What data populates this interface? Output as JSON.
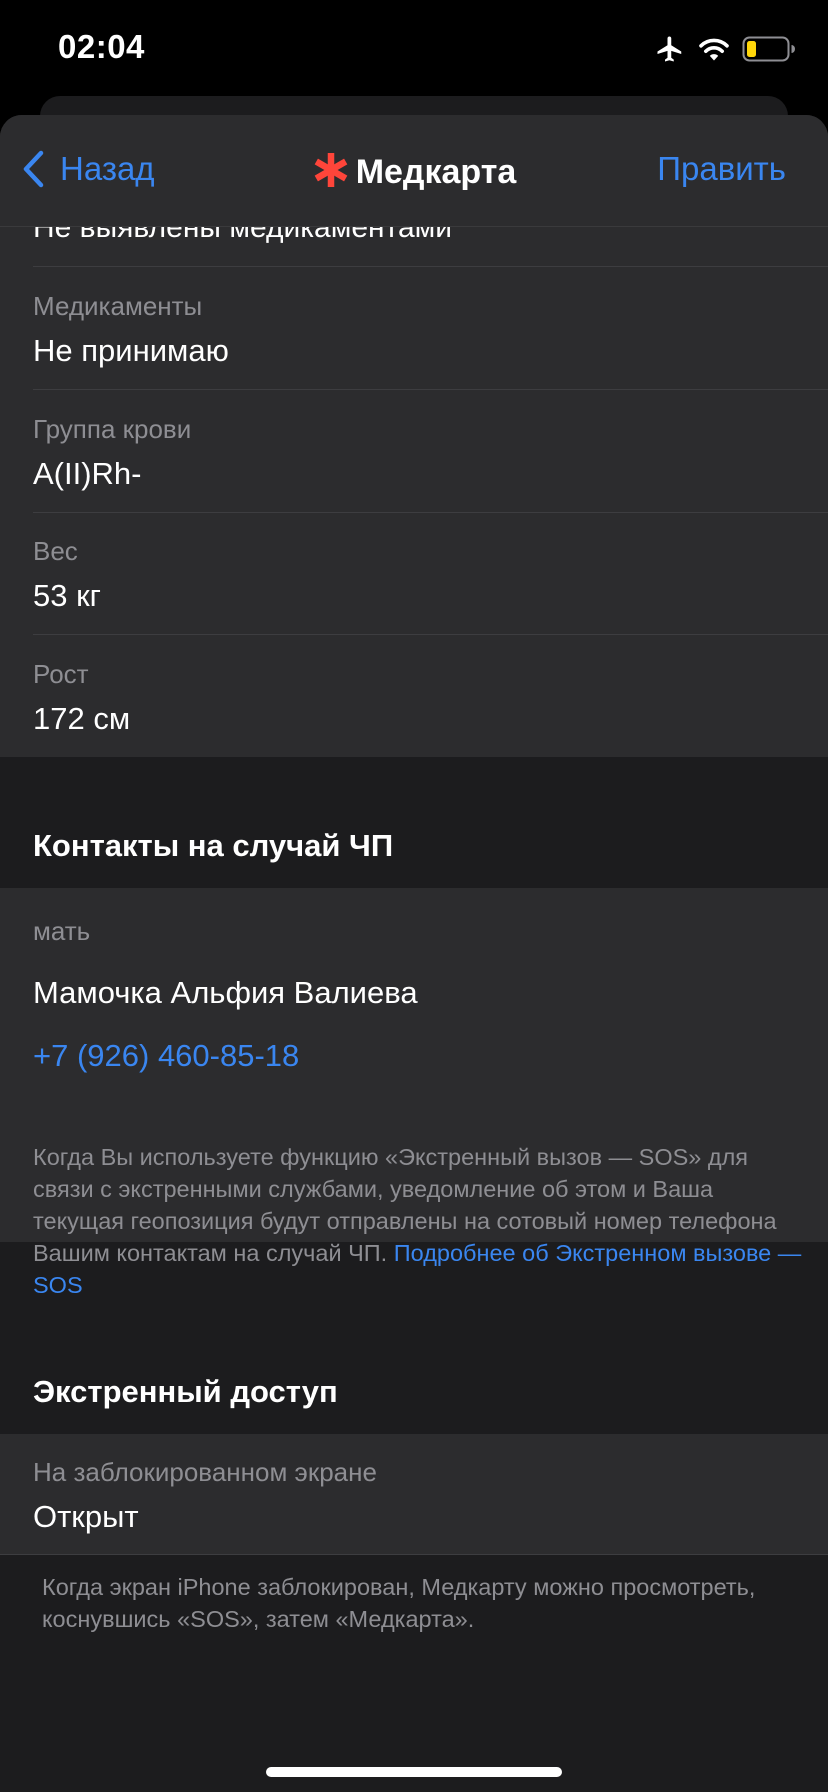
{
  "status_bar": {
    "time": "02:04",
    "icons": [
      "airplane-mode-icon",
      "wifi-icon",
      "battery-low-icon"
    ],
    "battery_color": "#ffd60a"
  },
  "nav": {
    "back_label": "Назад",
    "title": "Медкарта",
    "edit_label": "Править",
    "accent": "#3a86f0",
    "asterisk_color": "#ff453a"
  },
  "medical": {
    "cut_off_text": "Не выявлены медикаментами",
    "rows": [
      {
        "label": "Медикаменты",
        "value": "Не принимаю"
      },
      {
        "label": "Группа крови",
        "value": "A(II)Rh-"
      },
      {
        "label": "Вес",
        "value": "53 кг"
      },
      {
        "label": "Рост",
        "value": "172 см"
      }
    ]
  },
  "emergency_contacts": {
    "header": "Контакты на случай ЧП",
    "relation": "мать",
    "name": "Мамочка Альфия Валиева",
    "phone": "+7 (926) 460-85-18",
    "footnote": "Когда Вы используете функцию «Экстренный вызов — SOS» для связи с экстренными службами, уведомление об этом и Ваша текущая геопозиция будут отправлены на сотовый номер телефона Вашим контактам на случай ЧП.",
    "footnote_link": "Подробнее об Экстренном вызове — SOS"
  },
  "emergency_access": {
    "header": "Экстренный доступ",
    "label": "На заблокированном экране",
    "value": "Открыт",
    "footnote": "Когда экран iPhone заблокирован, Медкарту можно просмотреть, коснувшись «SOS», затем «Медкарта»."
  }
}
